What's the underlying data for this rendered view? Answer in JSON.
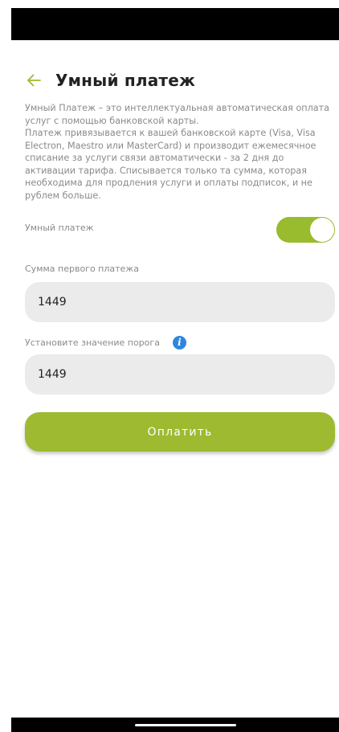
{
  "header": {
    "back_icon": "arrow-left-icon",
    "title": "Умный платеж"
  },
  "description": {
    "paragraph_1": "Умный Платеж – это интеллектуальная автоматическая оплата услуг с помощью банковской карты.",
    "paragraph_2": "Платеж привязывается к вашей банковской карте (Visa, Visa Electron, Maestro или MasterCard) и производит ежемесячное списание за услуги связи автоматически - за 2 дня до активации тарифа. Списывается только та сумма, которая необходима для продления услуги и оплаты подписок, и не рублем больше."
  },
  "smart_payment_toggle": {
    "label": "Умный платеж",
    "enabled": true
  },
  "first_payment": {
    "label": "Сумма первого платежа",
    "value": "1449"
  },
  "threshold": {
    "label": "Установите значение порога",
    "info_icon": "info-icon",
    "info_glyph": "i",
    "value": "1449"
  },
  "pay_button": {
    "label": "Оплатить"
  },
  "colors": {
    "accent": "#9dba31",
    "info": "#2e86de",
    "field_background": "#ebebeb",
    "muted_text": "#8a8a8a"
  }
}
